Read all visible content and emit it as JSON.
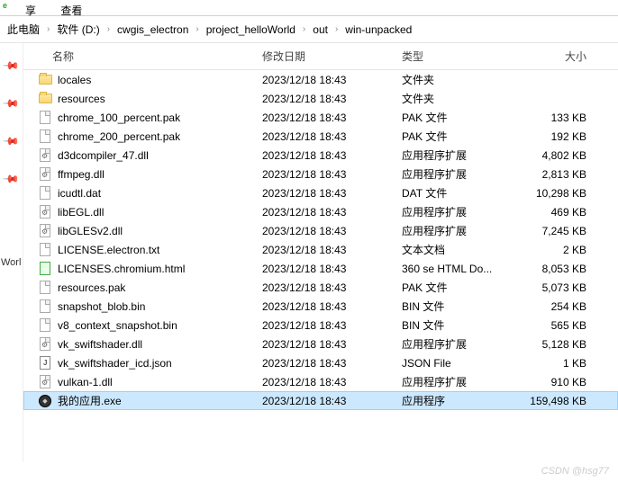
{
  "tabs": {
    "share": "享",
    "view": "查看"
  },
  "breadcrumb": [
    "此电脑",
    "软件 (D:)",
    "cwgis_electron",
    "project_helloWorld",
    "out",
    "win-unpacked"
  ],
  "columns": {
    "name": "名称",
    "date": "修改日期",
    "type": "类型",
    "size": "大小"
  },
  "side_truncated": "Worl",
  "files": [
    {
      "icon": "folder",
      "name": "locales",
      "date": "2023/12/18 18:43",
      "type": "文件夹",
      "size": ""
    },
    {
      "icon": "folder",
      "name": "resources",
      "date": "2023/12/18 18:43",
      "type": "文件夹",
      "size": ""
    },
    {
      "icon": "file",
      "name": "chrome_100_percent.pak",
      "date": "2023/12/18 18:43",
      "type": "PAK 文件",
      "size": "133 KB"
    },
    {
      "icon": "file",
      "name": "chrome_200_percent.pak",
      "date": "2023/12/18 18:43",
      "type": "PAK 文件",
      "size": "192 KB"
    },
    {
      "icon": "file-gear",
      "name": "d3dcompiler_47.dll",
      "date": "2023/12/18 18:43",
      "type": "应用程序扩展",
      "size": "4,802 KB"
    },
    {
      "icon": "file-gear",
      "name": "ffmpeg.dll",
      "date": "2023/12/18 18:43",
      "type": "应用程序扩展",
      "size": "2,813 KB"
    },
    {
      "icon": "file",
      "name": "icudtl.dat",
      "date": "2023/12/18 18:43",
      "type": "DAT 文件",
      "size": "10,298 KB"
    },
    {
      "icon": "file-gear",
      "name": "libEGL.dll",
      "date": "2023/12/18 18:43",
      "type": "应用程序扩展",
      "size": "469 KB"
    },
    {
      "icon": "file-gear",
      "name": "libGLESv2.dll",
      "date": "2023/12/18 18:43",
      "type": "应用程序扩展",
      "size": "7,245 KB"
    },
    {
      "icon": "file",
      "name": "LICENSE.electron.txt",
      "date": "2023/12/18 18:43",
      "type": "文本文档",
      "size": "2 KB"
    },
    {
      "icon": "file-html",
      "name": "LICENSES.chromium.html",
      "date": "2023/12/18 18:43",
      "type": "360 se HTML Do...",
      "size": "8,053 KB"
    },
    {
      "icon": "file",
      "name": "resources.pak",
      "date": "2023/12/18 18:43",
      "type": "PAK 文件",
      "size": "5,073 KB"
    },
    {
      "icon": "file",
      "name": "snapshot_blob.bin",
      "date": "2023/12/18 18:43",
      "type": "BIN 文件",
      "size": "254 KB"
    },
    {
      "icon": "file",
      "name": "v8_context_snapshot.bin",
      "date": "2023/12/18 18:43",
      "type": "BIN 文件",
      "size": "565 KB"
    },
    {
      "icon": "file-gear",
      "name": "vk_swiftshader.dll",
      "date": "2023/12/18 18:43",
      "type": "应用程序扩展",
      "size": "5,128 KB"
    },
    {
      "icon": "file-json",
      "name": "vk_swiftshader_icd.json",
      "date": "2023/12/18 18:43",
      "type": "JSON File",
      "size": "1 KB"
    },
    {
      "icon": "file-gear",
      "name": "vulkan-1.dll",
      "date": "2023/12/18 18:43",
      "type": "应用程序扩展",
      "size": "910 KB"
    },
    {
      "icon": "file-exe",
      "name": "我的应用.exe",
      "date": "2023/12/18 18:43",
      "type": "应用程序",
      "size": "159,498 KB",
      "selected": true
    }
  ],
  "watermark": "CSDN @hsg77"
}
